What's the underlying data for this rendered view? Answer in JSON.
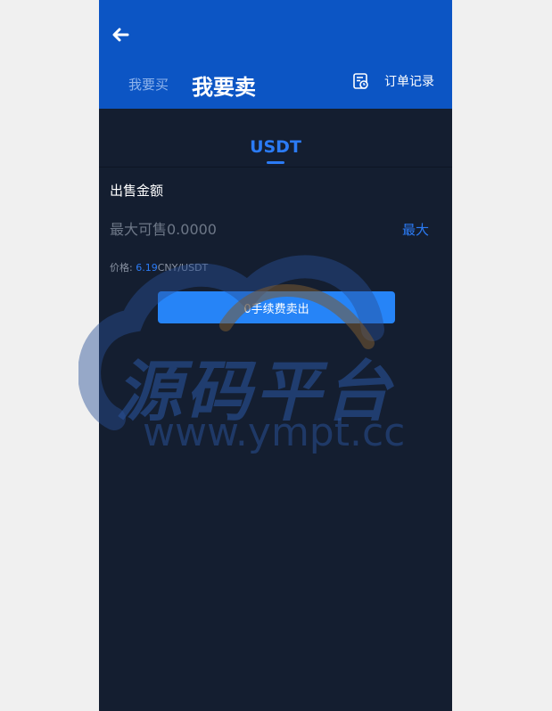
{
  "header": {
    "back_icon": "arrow-left-icon",
    "tab_buy": "我要买",
    "tab_sell": "我要卖",
    "order_icon": "order-record-icon",
    "order_label": "订单记录"
  },
  "coin_tab": {
    "label": "USDT"
  },
  "form": {
    "section_title": "出售金额",
    "amount_value": "",
    "amount_placeholder": "最大可售0.0000",
    "max_label": "最大",
    "price_label": "价格:",
    "price_value": "6.19",
    "price_unit": "CNY/USDT",
    "sell_button": "0手续费卖出"
  },
  "watermark": {
    "title": "源码平台",
    "url": "www.ympt.cc"
  },
  "colors": {
    "header_bg": "#0c55c4",
    "page_bg": "#141e30",
    "accent": "#2b7bf5",
    "button_bg": "#2684f7"
  }
}
